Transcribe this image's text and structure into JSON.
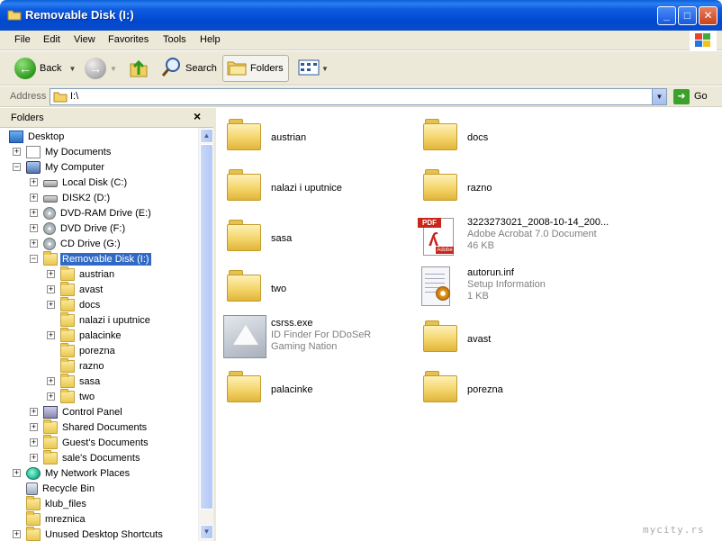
{
  "window": {
    "title": "Removable Disk (I:)",
    "min_label": "_",
    "max_label": "□",
    "close_label": "✕"
  },
  "menu": [
    "File",
    "Edit",
    "View",
    "Favorites",
    "Tools",
    "Help"
  ],
  "toolbar": {
    "back_label": "Back",
    "search_label": "Search",
    "folders_label": "Folders"
  },
  "address": {
    "label": "Address",
    "value": "I:\\",
    "go_label": "Go"
  },
  "folders_pane": {
    "title": "Folders",
    "close": "×",
    "tree": [
      {
        "label": "Desktop",
        "icon": "desktop-icon",
        "expander": "",
        "level": 0
      },
      {
        "label": "My Documents",
        "icon": "documents-icon",
        "expander": "+",
        "level": 1
      },
      {
        "label": "My Computer",
        "icon": "computer-icon",
        "expander": "−",
        "level": 1
      },
      {
        "label": "Local Disk (C:)",
        "icon": "drive-icon",
        "expander": "+",
        "level": 2
      },
      {
        "label": "DISK2 (D:)",
        "icon": "drive-icon",
        "expander": "+",
        "level": 2
      },
      {
        "label": "DVD-RAM Drive (E:)",
        "icon": "cd-drive-icon",
        "expander": "+",
        "level": 2
      },
      {
        "label": "DVD Drive (F:)",
        "icon": "cd-drive-icon",
        "expander": "+",
        "level": 2
      },
      {
        "label": "CD Drive (G:)",
        "icon": "cd-drive-icon",
        "expander": "+",
        "level": 2
      },
      {
        "label": "Removable Disk (I:)",
        "icon": "folder-open-icon",
        "expander": "−",
        "level": 2,
        "selected": true
      },
      {
        "label": "austrian",
        "icon": "folder-icon",
        "expander": "+",
        "level": 3
      },
      {
        "label": "avast",
        "icon": "folder-icon",
        "expander": "+",
        "level": 3
      },
      {
        "label": "docs",
        "icon": "folder-icon",
        "expander": "+",
        "level": 3
      },
      {
        "label": "nalazi i uputnice",
        "icon": "folder-icon",
        "expander": "",
        "level": 3
      },
      {
        "label": "palacinke",
        "icon": "folder-icon",
        "expander": "+",
        "level": 3
      },
      {
        "label": "porezna",
        "icon": "folder-icon",
        "expander": "",
        "level": 3
      },
      {
        "label": "razno",
        "icon": "folder-icon",
        "expander": "",
        "level": 3
      },
      {
        "label": "sasa",
        "icon": "folder-icon",
        "expander": "+",
        "level": 3
      },
      {
        "label": "two",
        "icon": "folder-icon",
        "expander": "+",
        "level": 3
      },
      {
        "label": "Control Panel",
        "icon": "control-panel-icon",
        "expander": "+",
        "level": 2
      },
      {
        "label": "Shared Documents",
        "icon": "folder-icon",
        "expander": "+",
        "level": 2
      },
      {
        "label": "Guest's Documents",
        "icon": "folder-icon",
        "expander": "+",
        "level": 2
      },
      {
        "label": "sale's Documents",
        "icon": "folder-icon",
        "expander": "+",
        "level": 2
      },
      {
        "label": "My Network Places",
        "icon": "network-icon",
        "expander": "+",
        "level": 1
      },
      {
        "label": "Recycle Bin",
        "icon": "recycle-bin-icon",
        "expander": "",
        "level": 1
      },
      {
        "label": "klub_files",
        "icon": "folder-icon",
        "expander": "",
        "level": 1
      },
      {
        "label": "mreznica",
        "icon": "folder-icon",
        "expander": "",
        "level": 1
      },
      {
        "label": "Unused Desktop Shortcuts",
        "icon": "folder-icon",
        "expander": "+",
        "level": 1
      }
    ]
  },
  "items": [
    {
      "name": "austrian",
      "type": "folder"
    },
    {
      "name": "docs",
      "type": "folder"
    },
    {
      "name": "nalazi i uputnice",
      "type": "folder"
    },
    {
      "name": "razno",
      "type": "folder"
    },
    {
      "name": "sasa",
      "type": "folder"
    },
    {
      "name": "3223273021_2008-10-14_200...",
      "type": "pdf",
      "desc": "Adobe Acrobat 7.0 Document",
      "size": "46 KB"
    },
    {
      "name": "two",
      "type": "folder"
    },
    {
      "name": "autorun.inf",
      "type": "inf",
      "desc": "Setup Information",
      "size": "1 KB"
    },
    {
      "name": "csrss.exe",
      "type": "exe",
      "desc": "ID Finder For DDoSeR",
      "desc2": "Gaming Nation"
    },
    {
      "name": "avast",
      "type": "folder"
    },
    {
      "name": "palacinke",
      "type": "folder"
    },
    {
      "name": "porezna",
      "type": "folder"
    }
  ],
  "pdf_badge": "PDF",
  "pdf_brand": "Adobe",
  "watermark": "mycity.rs"
}
